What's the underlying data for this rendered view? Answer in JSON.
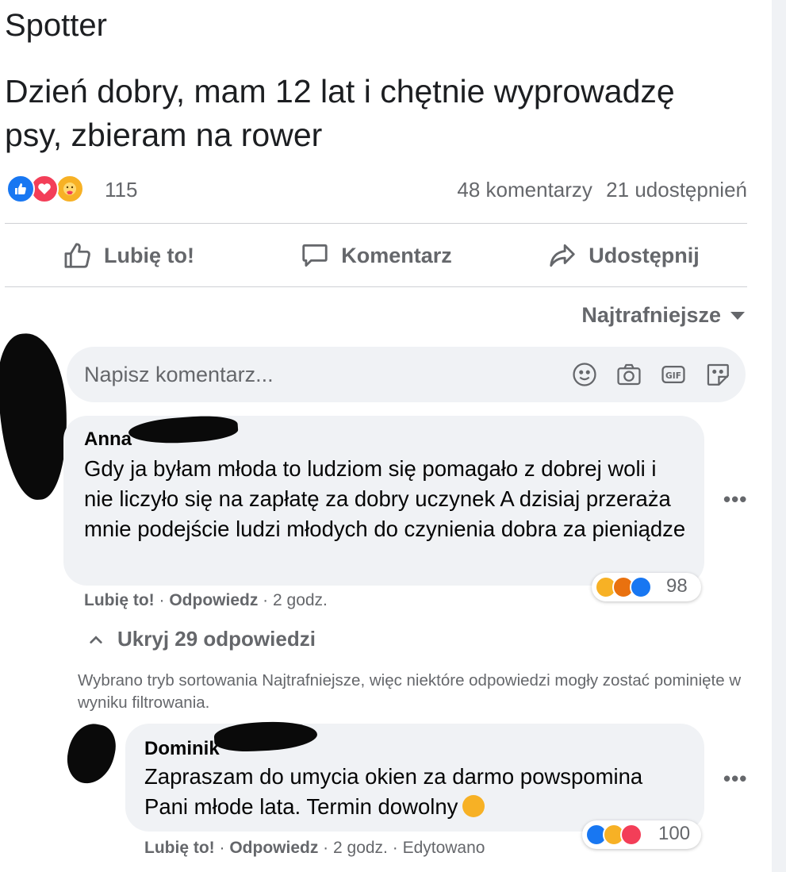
{
  "post": {
    "page_name": "Spotter",
    "text": "Dzień dobry, mam 12 lat i chętnie wyprowadzę psy, zbieram na rower",
    "reaction_count": "115",
    "reaction_icons": [
      "like-reaction-icon",
      "love-reaction-icon",
      "care-reaction-icon"
    ],
    "comments": "48 komentarzy",
    "shares": "21 udostępnień"
  },
  "actions": {
    "like": "Lubię to!",
    "comment": "Komentarz",
    "share": "Udostępnij"
  },
  "sort": {
    "label": "Najtrafniejsze"
  },
  "composer": {
    "placeholder": "Napisz komentarz...",
    "icons": [
      "emoji-icon",
      "camera-icon",
      "gif-icon",
      "sticker-icon"
    ]
  },
  "comments": [
    {
      "author": "Anna",
      "text": "Gdy ja byłam młoda to ludziom się pomagało z dobrej woli i nie liczyło się na zapłatę za dobry uczynek A dzisiaj przeraża mnie podejście ludzi młodych do czynienia dobra za pieniądze",
      "reaction_count": "98",
      "reaction_icons": [
        "haha-reaction-icon",
        "angry-reaction-icon",
        "like-reaction-icon"
      ],
      "like_label": "Lubię to!",
      "reply_label": "Odpowiedz",
      "time": "2 godz."
    }
  ],
  "replies_toggle": "Ukryj 29 odpowiedzi",
  "filter_note": "Wybrano tryb sortowania Najtrafniejsze, więc niektóre odpowiedzi mogły zostać pominięte w wyniku filtrowania.",
  "replies": [
    {
      "author": "Dominik",
      "text": "Zapraszam do umycia okien za darmo powspomina Pani młode lata. Termin dowolny",
      "reaction_count": "100",
      "reaction_icons": [
        "like-reaction-icon",
        "haha-reaction-icon",
        "love-reaction-icon"
      ],
      "like_label": "Lubię to!",
      "reply_label": "Odpowiedz",
      "time": "2 godz.",
      "edited": "Edytowano"
    }
  ],
  "colors": {
    "like_blue": "#1877f2",
    "love_red": "#f33e58",
    "care_yellow": "#f7b125",
    "secondary_text": "#65676b",
    "bubble_bg": "#f0f2f5"
  }
}
